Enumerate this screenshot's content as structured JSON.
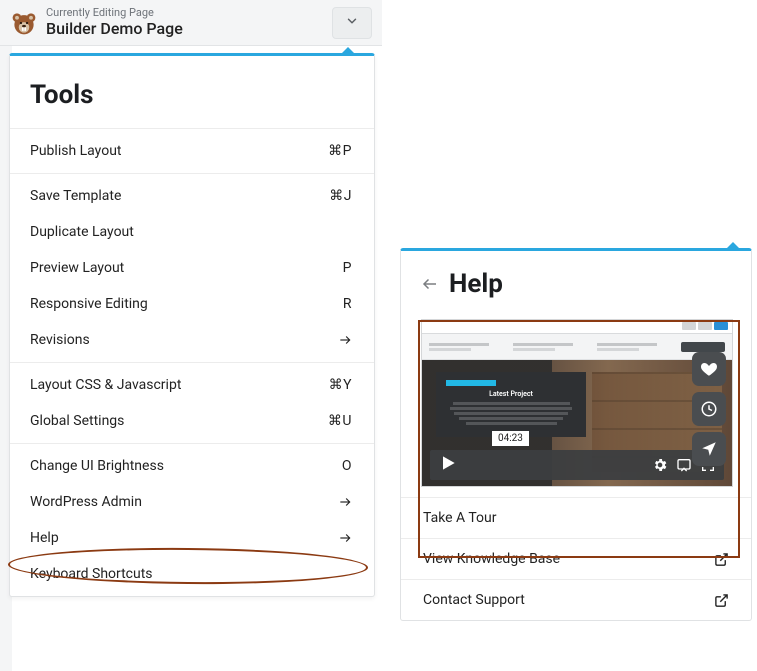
{
  "header": {
    "subtitle": "Currently Editing Page",
    "title": "Builder Demo Page"
  },
  "tools": {
    "heading": "Tools",
    "groups": [
      [
        {
          "label": "Publish Layout",
          "shortcut": "⌘P"
        }
      ],
      [
        {
          "label": "Save Template",
          "shortcut": "⌘J"
        },
        {
          "label": "Duplicate Layout",
          "shortcut": ""
        },
        {
          "label": "Preview Layout",
          "shortcut": "P"
        },
        {
          "label": "Responsive Editing",
          "shortcut": "R"
        },
        {
          "label": "Revisions",
          "shortcut": "",
          "arrow": true
        }
      ],
      [
        {
          "label": "Layout CSS & Javascript",
          "shortcut": "⌘Y"
        },
        {
          "label": "Global Settings",
          "shortcut": "⌘U"
        }
      ],
      [
        {
          "label": "Change UI Brightness",
          "shortcut": "O"
        },
        {
          "label": "WordPress Admin",
          "shortcut": "",
          "arrow": true
        },
        {
          "label": "Help",
          "shortcut": "",
          "arrow": true
        },
        {
          "label": "Keyboard Shortcuts",
          "shortcut": ""
        }
      ]
    ]
  },
  "help": {
    "heading": "Help",
    "video": {
      "duration": "04:23",
      "title": "Latest Project"
    },
    "items": [
      {
        "label": "Take A Tour",
        "external": false
      },
      {
        "label": "View Knowledge Base",
        "external": true
      },
      {
        "label": "Contact Support",
        "external": true
      }
    ]
  }
}
